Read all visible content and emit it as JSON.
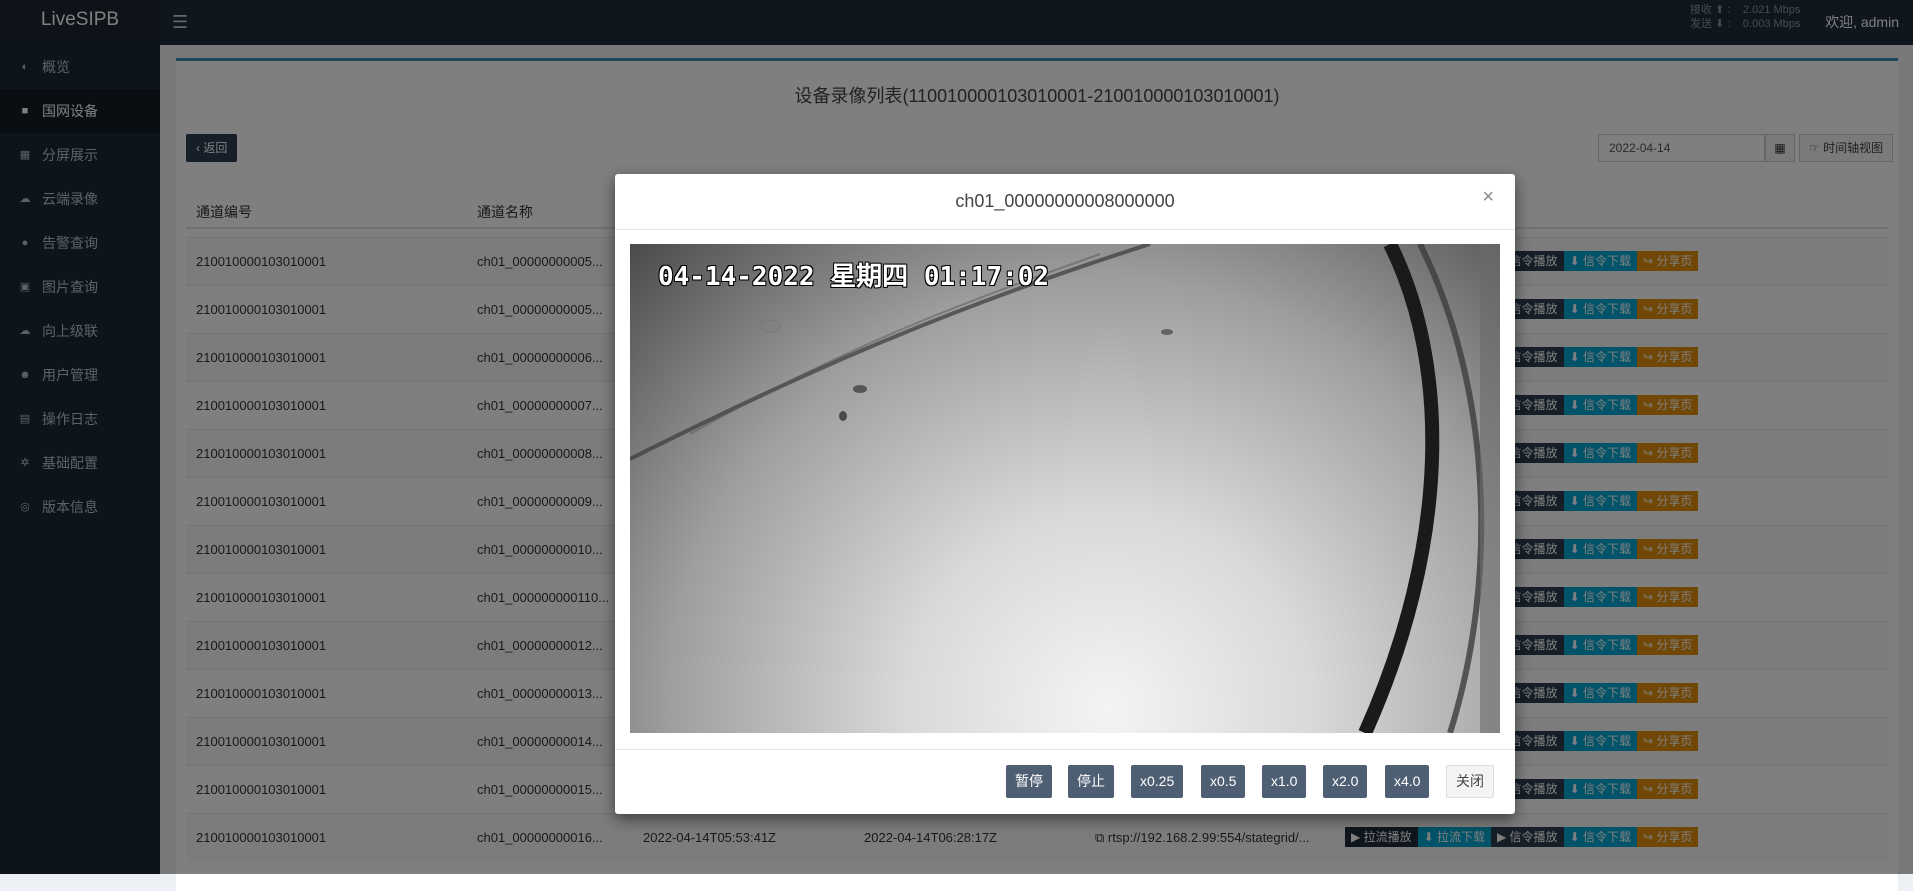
{
  "app": {
    "title": "LiveSIPB",
    "welcome": "欢迎, admin"
  },
  "netstats": {
    "recv_label": "接收 ⬆ :",
    "recv_value": "2.021 Mbps",
    "send_label": "发送 ⬇ :",
    "send_value": "0.003 Mbps"
  },
  "sidebar": {
    "items": [
      {
        "label": "概览",
        "icon": "dashboard-icon",
        "glyph": "◐"
      },
      {
        "label": "国网设备",
        "icon": "camera-icon",
        "glyph": "■"
      },
      {
        "label": "分屏展示",
        "icon": "grid-icon",
        "glyph": "▦"
      },
      {
        "label": "云端录像",
        "icon": "cloud-icon",
        "glyph": "☁"
      },
      {
        "label": "告警查询",
        "icon": "bell-icon",
        "glyph": "●"
      },
      {
        "label": "图片查询",
        "icon": "image-icon",
        "glyph": "▣"
      },
      {
        "label": "向上级联",
        "icon": "cloud-upload-icon",
        "glyph": "☁"
      },
      {
        "label": "用户管理",
        "icon": "users-icon",
        "glyph": "☻"
      },
      {
        "label": "操作日志",
        "icon": "file-icon",
        "glyph": "▤"
      },
      {
        "label": "基础配置",
        "icon": "cogs-icon",
        "glyph": "✲"
      },
      {
        "label": "版本信息",
        "icon": "globe-icon",
        "glyph": "◎"
      }
    ],
    "active_index": 1
  },
  "page": {
    "title": "设备录像列表(110010000103010001-210010000103010001)",
    "back_label": "返回",
    "date_value": "2022-04-14",
    "timeline_label": "时间轴视图"
  },
  "table": {
    "headers": [
      "通道编号",
      "通道名称"
    ],
    "action_labels": {
      "pull_play": "拉流播放",
      "pull_download": "拉流下载",
      "signal_play": "信令播放",
      "signal_download": "信令下载",
      "share": "分享页"
    },
    "rows": [
      {
        "id": "210010000103010001",
        "name": "ch01_00000000005..."
      },
      {
        "id": "210010000103010001",
        "name": "ch01_00000000005..."
      },
      {
        "id": "210010000103010001",
        "name": "ch01_00000000006..."
      },
      {
        "id": "210010000103010001",
        "name": "ch01_00000000007..."
      },
      {
        "id": "210010000103010001",
        "name": "ch01_00000000008..."
      },
      {
        "id": "210010000103010001",
        "name": "ch01_00000000009..."
      },
      {
        "id": "210010000103010001",
        "name": "ch01_00000000010..."
      },
      {
        "id": "210010000103010001",
        "name": "ch01_000000000110..."
      },
      {
        "id": "210010000103010001",
        "name": "ch01_00000000012..."
      },
      {
        "id": "210010000103010001",
        "name": "ch01_00000000013..."
      },
      {
        "id": "210010000103010001",
        "name": "ch01_00000000014..."
      },
      {
        "id": "210010000103010001",
        "name": "ch01_00000000015..."
      },
      {
        "id": "210010000103010001",
        "name": "ch01_00000000016...",
        "start": "2022-04-14T05:53:41Z",
        "end": "2022-04-14T06:28:17Z",
        "url": "rtsp://192.168.2.99:554/stategrid/..."
      }
    ]
  },
  "modal": {
    "title": "ch01_00000000008000000",
    "osd_text": "04-14-2022 星期四 01:17:02",
    "buttons": [
      "暂停",
      "停止",
      "x0.25",
      "x0.5",
      "x1.0",
      "x2.0",
      "x4.0"
    ],
    "close_label": "关闭"
  }
}
